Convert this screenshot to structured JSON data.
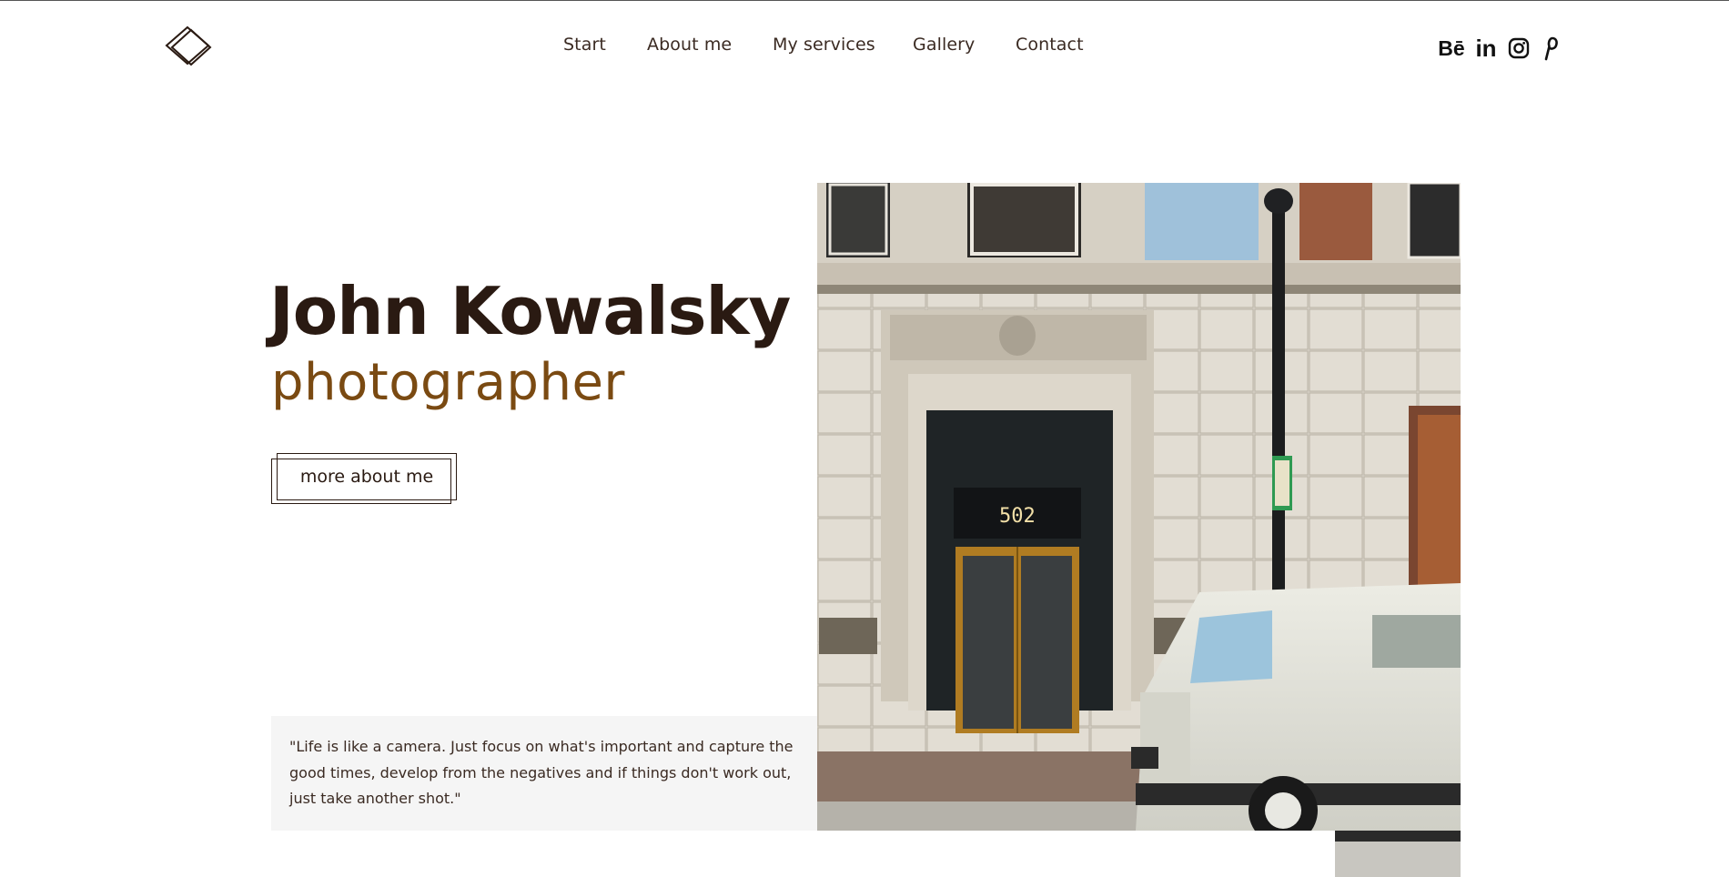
{
  "brand": {
    "logo": "diamond-logo"
  },
  "nav": {
    "items": [
      {
        "label": "Start"
      },
      {
        "label": "About me"
      },
      {
        "label": "My services"
      },
      {
        "label": "Gallery"
      },
      {
        "label": "Contact"
      }
    ]
  },
  "social": {
    "behance": "Bē",
    "linkedin": "in",
    "icons": [
      "behance-icon",
      "linkedin-icon",
      "instagram-icon",
      "pinterest-icon"
    ]
  },
  "hero": {
    "name": "John Kowalsky",
    "role": "photographer",
    "cta_label": "more about me",
    "quote": "\"Life is like a camera. Just focus on what's important and capture the good times, develop from the negatives and if things don't work out, just take another shot.\"",
    "door_number": "502"
  },
  "colors": {
    "name": "#2a1a12",
    "role": "#7a4a12",
    "quote_bg": "#f5f5f5"
  }
}
